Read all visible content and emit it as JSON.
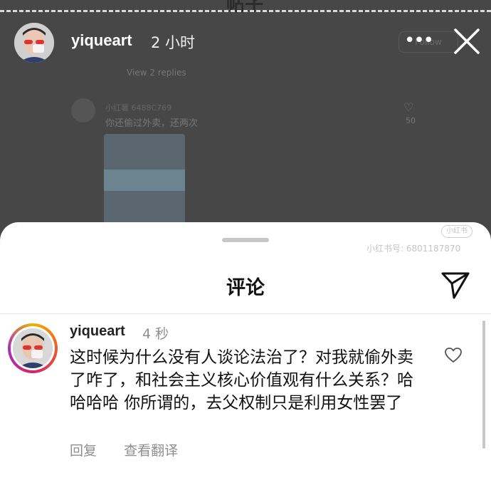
{
  "background": {
    "title": "帖子",
    "follow_label": "Follow",
    "view_replies": "View 2 replies",
    "comment_user": "小红薯 6488C769",
    "comment_text": "你还偷过外卖，还两次",
    "like_count": "50"
  },
  "story": {
    "username": "yiqueart",
    "time": "2 小时",
    "more_icon": "more-horizontal-icon",
    "close_icon": "close-icon"
  },
  "sheet": {
    "title": "评论",
    "send_icon": "send-icon"
  },
  "comment": {
    "username": "yiqueart",
    "time": "4 秒",
    "text": "这时候为什么没有人谈论法治了？对我就偷外卖了咋了，和社会主义核心价值观有什么关系？哈哈哈哈 你所谓的，去父权制只是利用女性罢了",
    "reply_label": "回复",
    "translate_label": "查看翻译",
    "heart_icon": "heart-outline-icon"
  },
  "watermark": {
    "logo": "小红书",
    "id_text": "小红书号: 6801187870"
  }
}
